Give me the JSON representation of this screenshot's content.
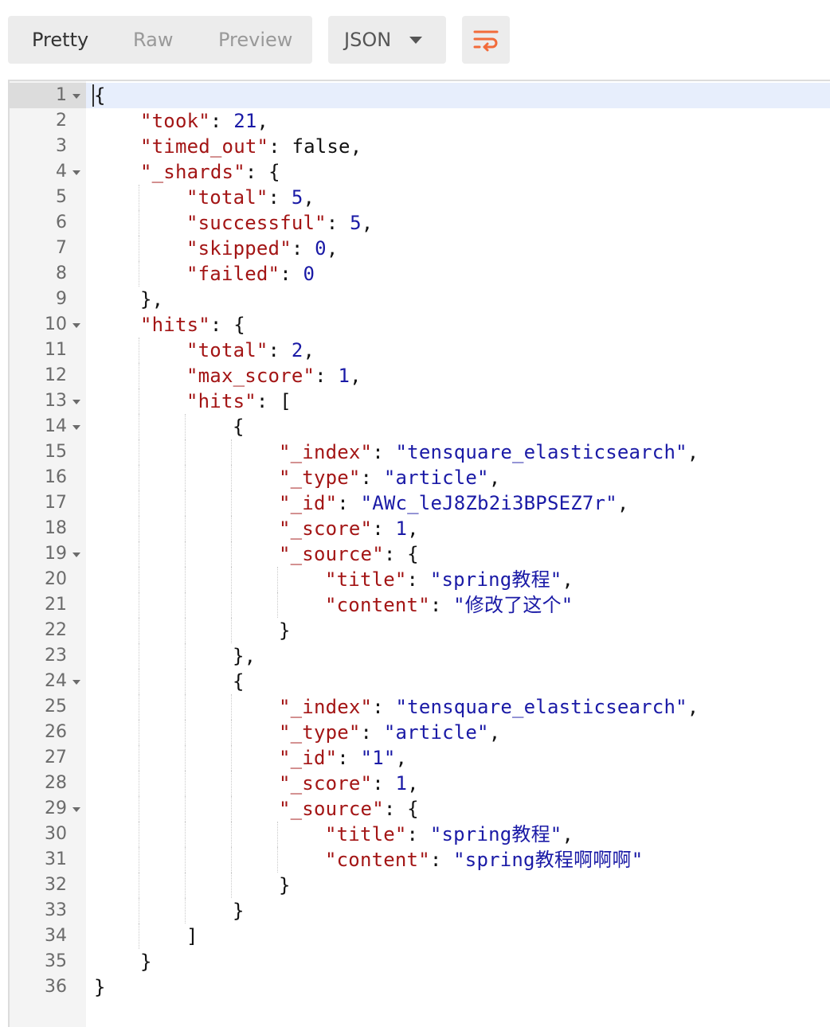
{
  "toolbar": {
    "tabs": [
      {
        "label": "Pretty",
        "active": true
      },
      {
        "label": "Raw",
        "active": false
      },
      {
        "label": "Preview",
        "active": false
      }
    ],
    "format_select": "JSON",
    "wrap_icon": "wrap-lines-icon",
    "accent_color": "#f26b3a"
  },
  "editor": {
    "lines": [
      {
        "n": "1",
        "fold": true,
        "indent": 0,
        "parts": [
          [
            "p",
            "{"
          ]
        ]
      },
      {
        "n": "2",
        "fold": false,
        "indent": 1,
        "parts": [
          [
            "k",
            "\"took\""
          ],
          [
            "p",
            ": "
          ],
          [
            "n",
            "21"
          ],
          [
            "p",
            ","
          ]
        ]
      },
      {
        "n": "3",
        "fold": false,
        "indent": 1,
        "parts": [
          [
            "k",
            "\"timed_out\""
          ],
          [
            "p",
            ": false,"
          ]
        ]
      },
      {
        "n": "4",
        "fold": true,
        "indent": 1,
        "parts": [
          [
            "k",
            "\"_shards\""
          ],
          [
            "p",
            ": {"
          ]
        ]
      },
      {
        "n": "5",
        "fold": false,
        "indent": 2,
        "parts": [
          [
            "k",
            "\"total\""
          ],
          [
            "p",
            ": "
          ],
          [
            "n",
            "5"
          ],
          [
            "p",
            ","
          ]
        ]
      },
      {
        "n": "6",
        "fold": false,
        "indent": 2,
        "parts": [
          [
            "k",
            "\"successful\""
          ],
          [
            "p",
            ": "
          ],
          [
            "n",
            "5"
          ],
          [
            "p",
            ","
          ]
        ]
      },
      {
        "n": "7",
        "fold": false,
        "indent": 2,
        "parts": [
          [
            "k",
            "\"skipped\""
          ],
          [
            "p",
            ": "
          ],
          [
            "n",
            "0"
          ],
          [
            "p",
            ","
          ]
        ]
      },
      {
        "n": "8",
        "fold": false,
        "indent": 2,
        "parts": [
          [
            "k",
            "\"failed\""
          ],
          [
            "p",
            ": "
          ],
          [
            "n",
            "0"
          ]
        ]
      },
      {
        "n": "9",
        "fold": false,
        "indent": 1,
        "parts": [
          [
            "p",
            "},"
          ]
        ]
      },
      {
        "n": "10",
        "fold": true,
        "indent": 1,
        "parts": [
          [
            "k",
            "\"hits\""
          ],
          [
            "p",
            ": {"
          ]
        ]
      },
      {
        "n": "11",
        "fold": false,
        "indent": 2,
        "parts": [
          [
            "k",
            "\"total\""
          ],
          [
            "p",
            ": "
          ],
          [
            "n",
            "2"
          ],
          [
            "p",
            ","
          ]
        ]
      },
      {
        "n": "12",
        "fold": false,
        "indent": 2,
        "parts": [
          [
            "k",
            "\"max_score\""
          ],
          [
            "p",
            ": "
          ],
          [
            "n",
            "1"
          ],
          [
            "p",
            ","
          ]
        ]
      },
      {
        "n": "13",
        "fold": true,
        "indent": 2,
        "parts": [
          [
            "k",
            "\"hits\""
          ],
          [
            "p",
            ": ["
          ]
        ]
      },
      {
        "n": "14",
        "fold": true,
        "indent": 3,
        "parts": [
          [
            "p",
            "{"
          ]
        ]
      },
      {
        "n": "15",
        "fold": false,
        "indent": 4,
        "parts": [
          [
            "k",
            "\"_index\""
          ],
          [
            "p",
            ": "
          ],
          [
            "s",
            "\"tensquare_elasticsearch\""
          ],
          [
            "p",
            ","
          ]
        ]
      },
      {
        "n": "16",
        "fold": false,
        "indent": 4,
        "parts": [
          [
            "k",
            "\"_type\""
          ],
          [
            "p",
            ": "
          ],
          [
            "s",
            "\"article\""
          ],
          [
            "p",
            ","
          ]
        ]
      },
      {
        "n": "17",
        "fold": false,
        "indent": 4,
        "parts": [
          [
            "k",
            "\"_id\""
          ],
          [
            "p",
            ": "
          ],
          [
            "s",
            "\"AWc_leJ8Zb2i3BPSEZ7r\""
          ],
          [
            "p",
            ","
          ]
        ]
      },
      {
        "n": "18",
        "fold": false,
        "indent": 4,
        "parts": [
          [
            "k",
            "\"_score\""
          ],
          [
            "p",
            ": "
          ],
          [
            "n",
            "1"
          ],
          [
            "p",
            ","
          ]
        ]
      },
      {
        "n": "19",
        "fold": true,
        "indent": 4,
        "parts": [
          [
            "k",
            "\"_source\""
          ],
          [
            "p",
            ": {"
          ]
        ]
      },
      {
        "n": "20",
        "fold": false,
        "indent": 5,
        "parts": [
          [
            "k",
            "\"title\""
          ],
          [
            "p",
            ": "
          ],
          [
            "s",
            "\"spring教程\""
          ],
          [
            "p",
            ","
          ]
        ]
      },
      {
        "n": "21",
        "fold": false,
        "indent": 5,
        "parts": [
          [
            "k",
            "\"content\""
          ],
          [
            "p",
            ": "
          ],
          [
            "s",
            "\"修改了这个\""
          ]
        ]
      },
      {
        "n": "22",
        "fold": false,
        "indent": 4,
        "parts": [
          [
            "p",
            "}"
          ]
        ]
      },
      {
        "n": "23",
        "fold": false,
        "indent": 3,
        "parts": [
          [
            "p",
            "},"
          ]
        ]
      },
      {
        "n": "24",
        "fold": true,
        "indent": 3,
        "parts": [
          [
            "p",
            "{"
          ]
        ]
      },
      {
        "n": "25",
        "fold": false,
        "indent": 4,
        "parts": [
          [
            "k",
            "\"_index\""
          ],
          [
            "p",
            ": "
          ],
          [
            "s",
            "\"tensquare_elasticsearch\""
          ],
          [
            "p",
            ","
          ]
        ]
      },
      {
        "n": "26",
        "fold": false,
        "indent": 4,
        "parts": [
          [
            "k",
            "\"_type\""
          ],
          [
            "p",
            ": "
          ],
          [
            "s",
            "\"article\""
          ],
          [
            "p",
            ","
          ]
        ]
      },
      {
        "n": "27",
        "fold": false,
        "indent": 4,
        "parts": [
          [
            "k",
            "\"_id\""
          ],
          [
            "p",
            ": "
          ],
          [
            "s",
            "\"1\""
          ],
          [
            "p",
            ","
          ]
        ]
      },
      {
        "n": "28",
        "fold": false,
        "indent": 4,
        "parts": [
          [
            "k",
            "\"_score\""
          ],
          [
            "p",
            ": "
          ],
          [
            "n",
            "1"
          ],
          [
            "p",
            ","
          ]
        ]
      },
      {
        "n": "29",
        "fold": true,
        "indent": 4,
        "parts": [
          [
            "k",
            "\"_source\""
          ],
          [
            "p",
            ": {"
          ]
        ]
      },
      {
        "n": "30",
        "fold": false,
        "indent": 5,
        "parts": [
          [
            "k",
            "\"title\""
          ],
          [
            "p",
            ": "
          ],
          [
            "s",
            "\"spring教程\""
          ],
          [
            "p",
            ","
          ]
        ]
      },
      {
        "n": "31",
        "fold": false,
        "indent": 5,
        "parts": [
          [
            "k",
            "\"content\""
          ],
          [
            "p",
            ": "
          ],
          [
            "s",
            "\"spring教程啊啊啊\""
          ]
        ]
      },
      {
        "n": "32",
        "fold": false,
        "indent": 4,
        "parts": [
          [
            "p",
            "}"
          ]
        ]
      },
      {
        "n": "33",
        "fold": false,
        "indent": 3,
        "parts": [
          [
            "p",
            "}"
          ]
        ]
      },
      {
        "n": "34",
        "fold": false,
        "indent": 2,
        "parts": [
          [
            "p",
            "]"
          ]
        ]
      },
      {
        "n": "35",
        "fold": false,
        "indent": 1,
        "parts": [
          [
            "p",
            "}"
          ]
        ]
      },
      {
        "n": "36",
        "fold": false,
        "indent": 0,
        "parts": [
          [
            "p",
            "}"
          ]
        ]
      }
    ]
  }
}
